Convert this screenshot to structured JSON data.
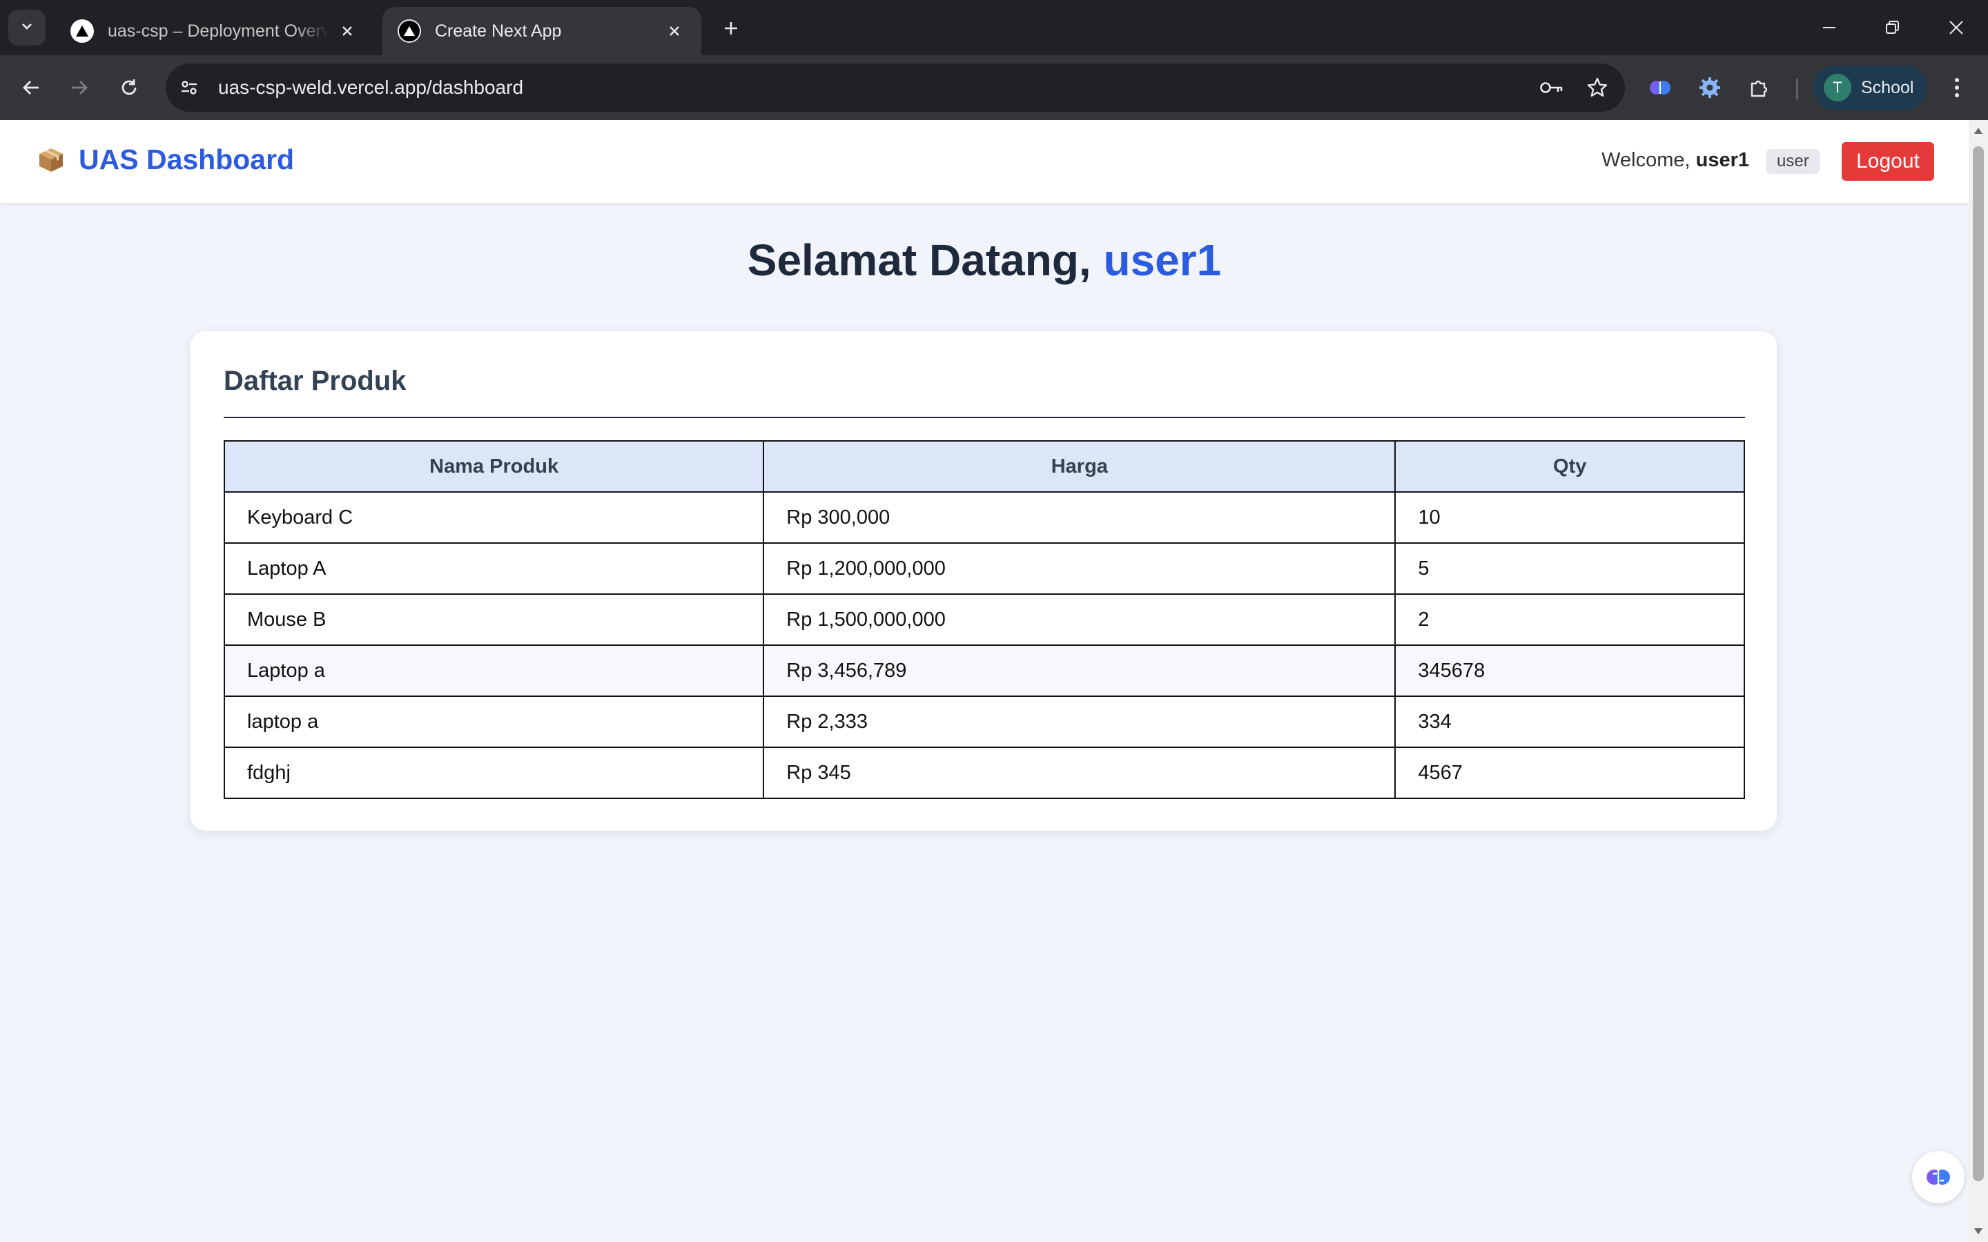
{
  "browser": {
    "tabs": [
      {
        "title": "uas-csp – Deployment Overview",
        "active": false
      },
      {
        "title": "Create Next App",
        "active": true
      }
    ],
    "url": "uas-csp-weld.vercel.app/dashboard",
    "profile": {
      "initial": "T",
      "label": "School"
    }
  },
  "app": {
    "brand": "UAS Dashboard",
    "welcome_prefix": "Welcome, ",
    "username": "user1",
    "role": "user",
    "logout_label": "Logout"
  },
  "main": {
    "greeting_prefix": "Selamat Datang, ",
    "greeting_name": "user1",
    "card_title": "Daftar Produk",
    "table": {
      "columns": [
        "Nama Produk",
        "Harga",
        "Qty"
      ],
      "rows": [
        [
          "Keyboard C",
          "Rp 300,000",
          "10"
        ],
        [
          "Laptop A",
          "Rp 1,200,000,000",
          "5"
        ],
        [
          "Mouse B",
          "Rp 1,500,000,000",
          "2"
        ],
        [
          "Laptop a",
          "Rp 3,456,789",
          "345678"
        ],
        [
          "laptop a",
          "Rp 2,333",
          "334"
        ],
        [
          "fdghj",
          "Rp 345",
          "4567"
        ]
      ]
    }
  },
  "colors": {
    "accent": "#2b5be0",
    "logout": "#e53a3a",
    "table_header": "#dbe6f8",
    "page_bg": "#f1f4fa"
  }
}
